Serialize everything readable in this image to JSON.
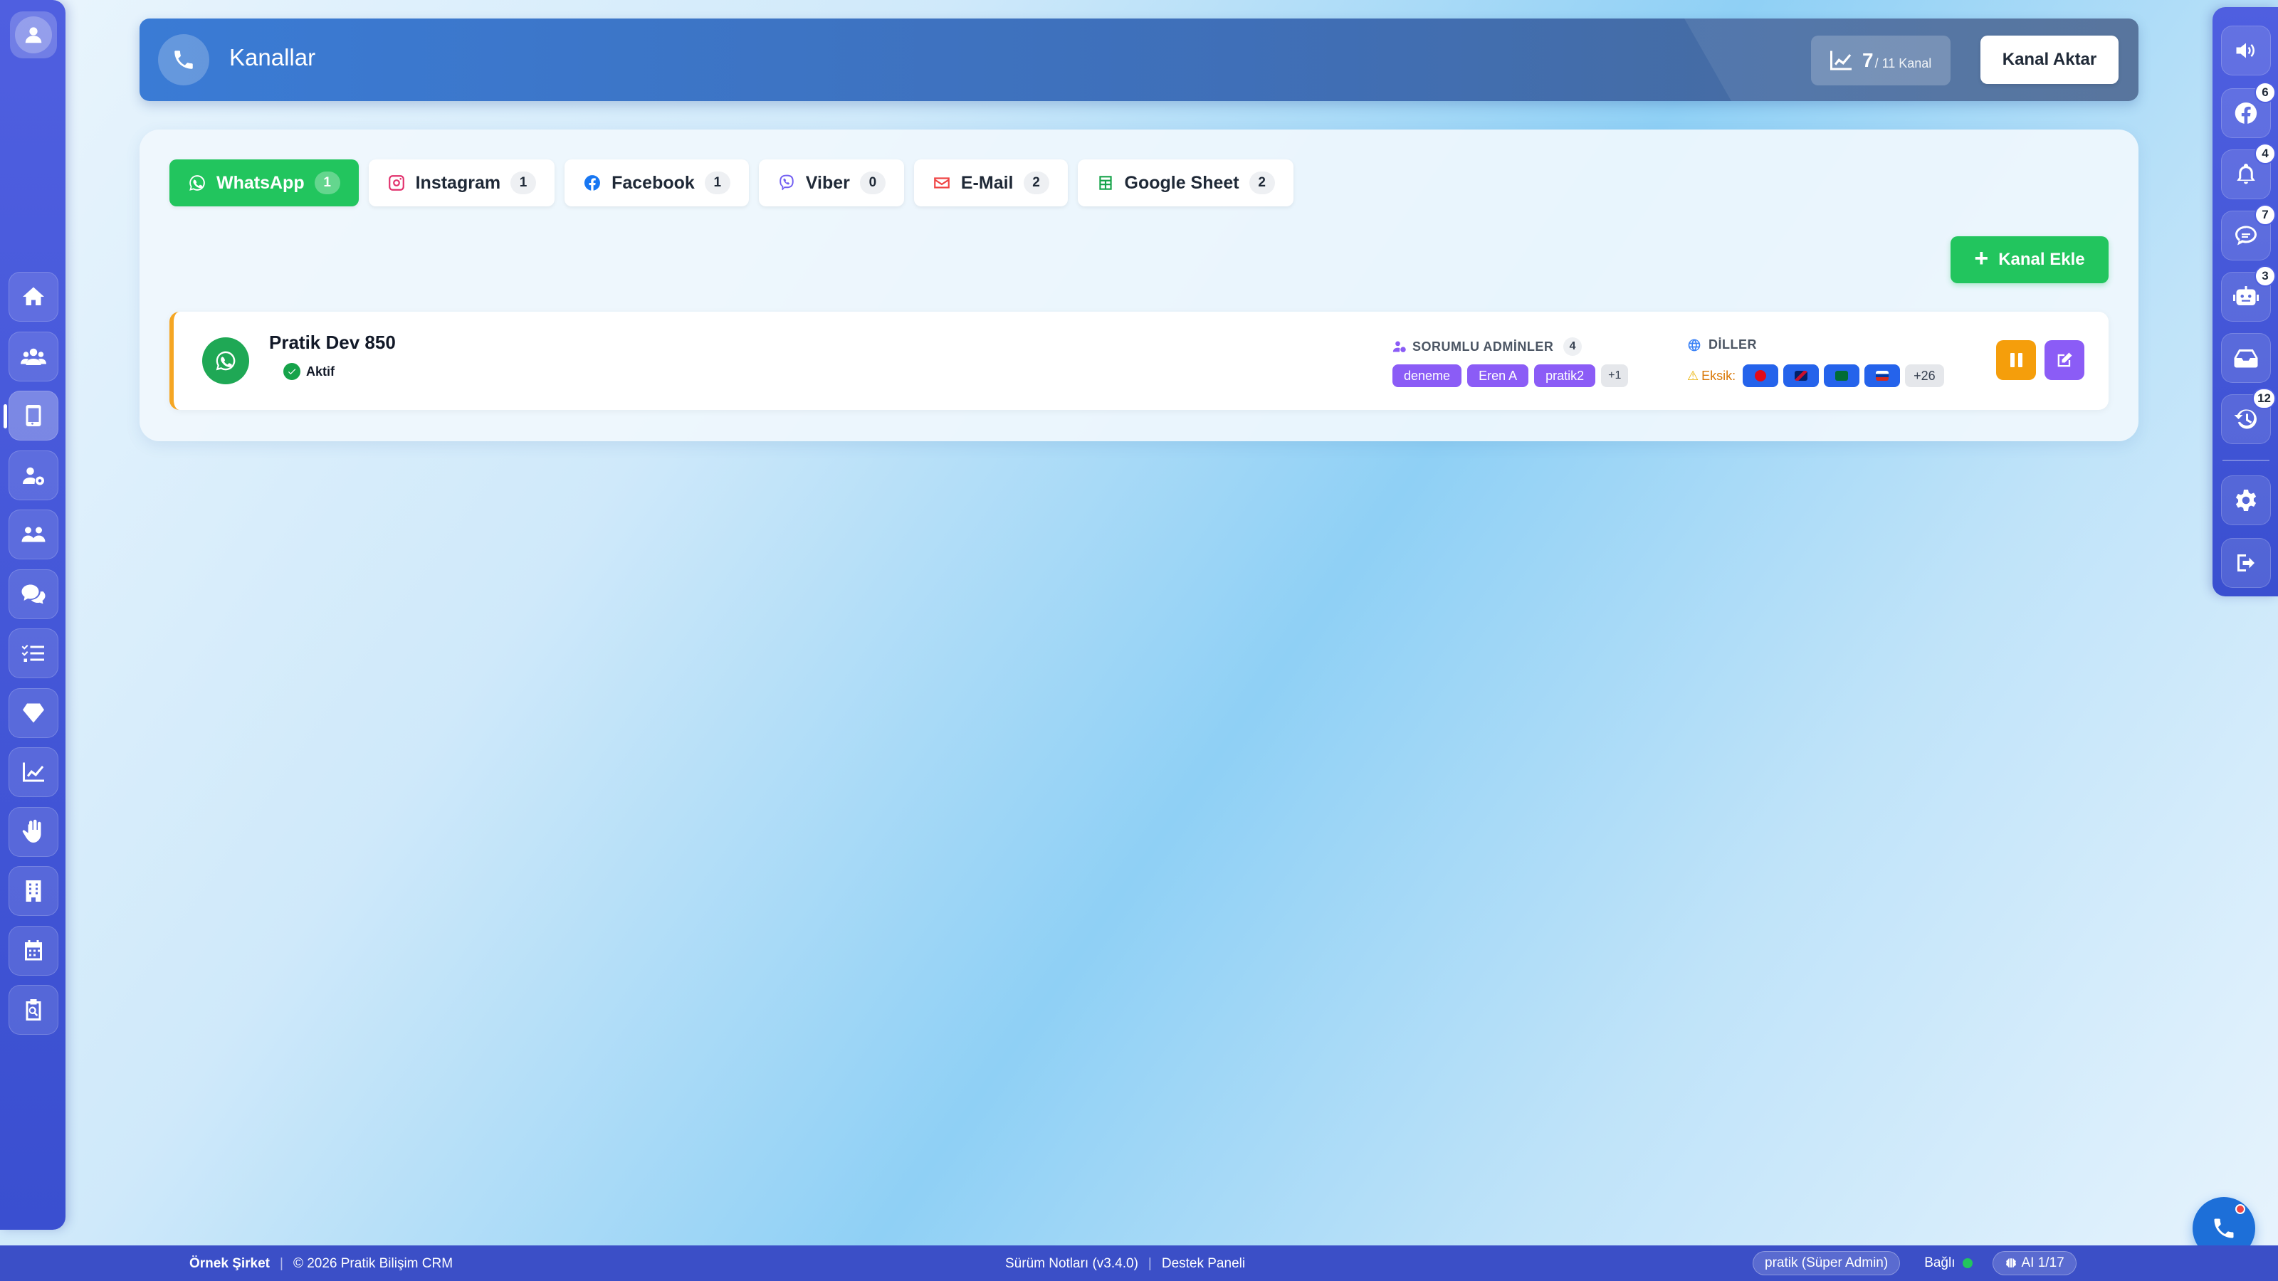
{
  "header": {
    "title": "Kanallar",
    "count_value": "7",
    "count_suffix": "/ 11 Kanal",
    "import_button": "Kanal Aktar"
  },
  "tabs": [
    {
      "label": "WhatsApp",
      "count": "1",
      "icon": "whatsapp-icon",
      "color": "#22c55e",
      "active": true
    },
    {
      "label": "Instagram",
      "count": "1",
      "icon": "instagram-icon",
      "color": "#e1306c"
    },
    {
      "label": "Facebook",
      "count": "1",
      "icon": "facebook-icon",
      "color": "#1877f2"
    },
    {
      "label": "Viber",
      "count": "0",
      "icon": "viber-icon",
      "color": "#7360f2"
    },
    {
      "label": "E-Mail",
      "count": "2",
      "icon": "mail-icon",
      "color": "#ef4444"
    },
    {
      "label": "Google Sheet",
      "count": "2",
      "icon": "sheet-icon",
      "color": "#16a34a"
    }
  ],
  "add_channel_button": "Kanal Ekle",
  "channel": {
    "name": "Pratik Dev 850",
    "status": "Aktif",
    "admins_label": "SORUMLU ADMİNLER",
    "admins_count": "4",
    "admins": [
      "deneme",
      "Eren A",
      "pratik2"
    ],
    "admins_more": "+1",
    "languages_label": "DİLLER",
    "missing_label": "Eksik:",
    "flags": [
      "tr-flag",
      "gb-flag",
      "sa-flag",
      "ru-flag"
    ],
    "flags_more": "+26",
    "accent_color": "#f5a623"
  },
  "right_badges": {
    "facebook": "6",
    "notifications": "4",
    "comments": "7",
    "bot": "3",
    "history": "12"
  },
  "footer": {
    "company": "Örnek Şirket",
    "copyright": "© 2026 Pratik Bilişim CRM",
    "release_notes": "Sürüm Notları (v3.4.0)",
    "support": "Destek Paneli",
    "user": "pratik (Süper Admin)",
    "connection": "Bağlı",
    "ai": "AI 1/17"
  }
}
